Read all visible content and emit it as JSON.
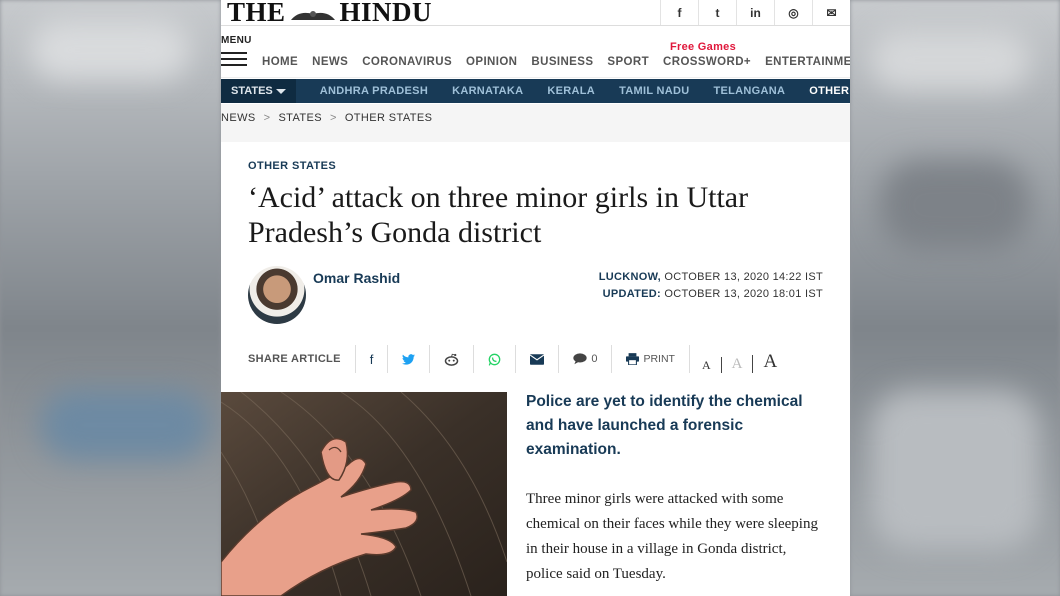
{
  "masthead": {
    "logo_left": "THE",
    "logo_right": "HINDU",
    "social_icons": [
      "facebook-icon",
      "twitter-icon",
      "linkedin-icon",
      "instagram-icon",
      "mail-icon"
    ],
    "social_glyphs": [
      "f",
      "t",
      "in",
      "◎",
      "✉"
    ]
  },
  "nav": {
    "menu_label": "MENU",
    "links": [
      "HOME",
      "NEWS",
      "CORONAVIRUS",
      "OPINION",
      "BUSINESS",
      "SPORT",
      "CROSSWORD+",
      "ENTERTAINMENT"
    ],
    "promo": "Free Games"
  },
  "states_bar": {
    "button": "STATES",
    "items": [
      "ANDHRA PRADESH",
      "KARNATAKA",
      "KERALA",
      "TAMIL NADU",
      "TELANGANA",
      "OTHER STA"
    ]
  },
  "breadcrumb": [
    "NEWS",
    "STATES",
    "OTHER STATES"
  ],
  "article": {
    "kicker": "OTHER STATES",
    "headline": "‘Acid’ attack on three minor girls in Uttar Pradesh’s Gonda district",
    "author": "Omar Rashid",
    "location": "LUCKNOW,",
    "published": "OCTOBER 13, 2020 14:22 IST",
    "updated_label": "UPDATED:",
    "updated": "OCTOBER 13, 2020 18:01 IST",
    "lede": "Police are yet to identify the chemical and have launched a forensic examination.",
    "body": "Three minor girls were attacked with some chemical on their faces while they were sleeping in their house in a village in Gonda district, police said on Tuesday."
  },
  "share": {
    "label": "SHARE ARTICLE",
    "comments_count": "0",
    "print_label": "PRINT",
    "font_sizes": [
      "A",
      "A",
      "A"
    ]
  },
  "colors": {
    "navy": "#183a56",
    "red": "#e0173b"
  }
}
